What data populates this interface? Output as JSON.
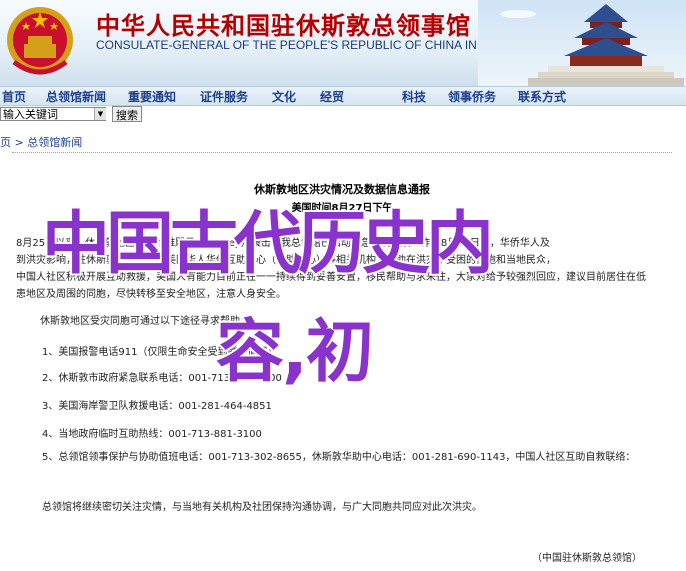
{
  "header": {
    "title_cn": "中华人民共和国驻休斯敦总领事馆",
    "title_en": "CONSULATE-GENERAL OF THE PEOPLE'S REPUBLIC OF CHINA IN HOUSTON"
  },
  "nav": {
    "items": [
      "首页",
      "总领馆新闻",
      "重要通知",
      "证件服务",
      "文化",
      "经贸",
      "科技",
      "领事侨务",
      "联系方式"
    ]
  },
  "search": {
    "value": "输入关键词",
    "button": "搜索"
  },
  "breadcrumb": {
    "home": "页",
    "sep": ">",
    "current": "总领馆新闻"
  },
  "article": {
    "title": "休斯敦地区洪灾情况及数据信息通报",
    "subtitle": "美国时间8月27日下午",
    "para1_lines": [
      "8月25日以来，休斯敦地区遭受哈维飓风（Harvey）袭击，我总领馆已启动应急机制开展工作。8月26日起，华侨华人及",
      "到洪灾影响，驻休斯敦总领馆会同美国华人华侨互助中心（华助中心）等相关机构，帮助在洪灾中受困的侨胞和当地民众，",
      "中国人社区积极开展互助救援，美国人有能力目前正在一一持续得到妥善安置，移民帮助与求来往，大家对给予较强烈回应，建议目前居住在低",
      "患地区及周围的同胞，尽快转移至安全地区，注意人身安全。"
    ],
    "para2": "休斯敦地区受灾同胞可通过以下途径寻求帮助：",
    "list": [
      "1、美国报警电话911（仅限生命安全受到威胁情况）",
      "2、休斯敦市政府紧急联系电话：001-713-884-4500",
      "3、美国海岸警卫队救援电话：001-281-464-4851",
      "4、当地政府临时互助热线：001-713-881-3100",
      "5、总领馆领事保护与协助值班电话：001-713-302-8655，休斯敦华助中心电话：001-281-690-1143，中国人社区互助自救联络："
    ],
    "closing": "总领馆将继续密切关注灾情，与当地有关机构及社团保持沟通协调，与广大同胞共同应对此次洪灾。",
    "sign": "（中国驻休斯敦总领馆）"
  },
  "watermark": {
    "line1": "中国古代历史内",
    "line2": "容,初"
  },
  "colors": {
    "nav_text": "#1e3f8c",
    "title_red": "#b30000",
    "watermark": "#8a33cc"
  },
  "icons": [
    "national-emblem-icon",
    "temple-icon",
    "dropdown-arrow-icon"
  ]
}
